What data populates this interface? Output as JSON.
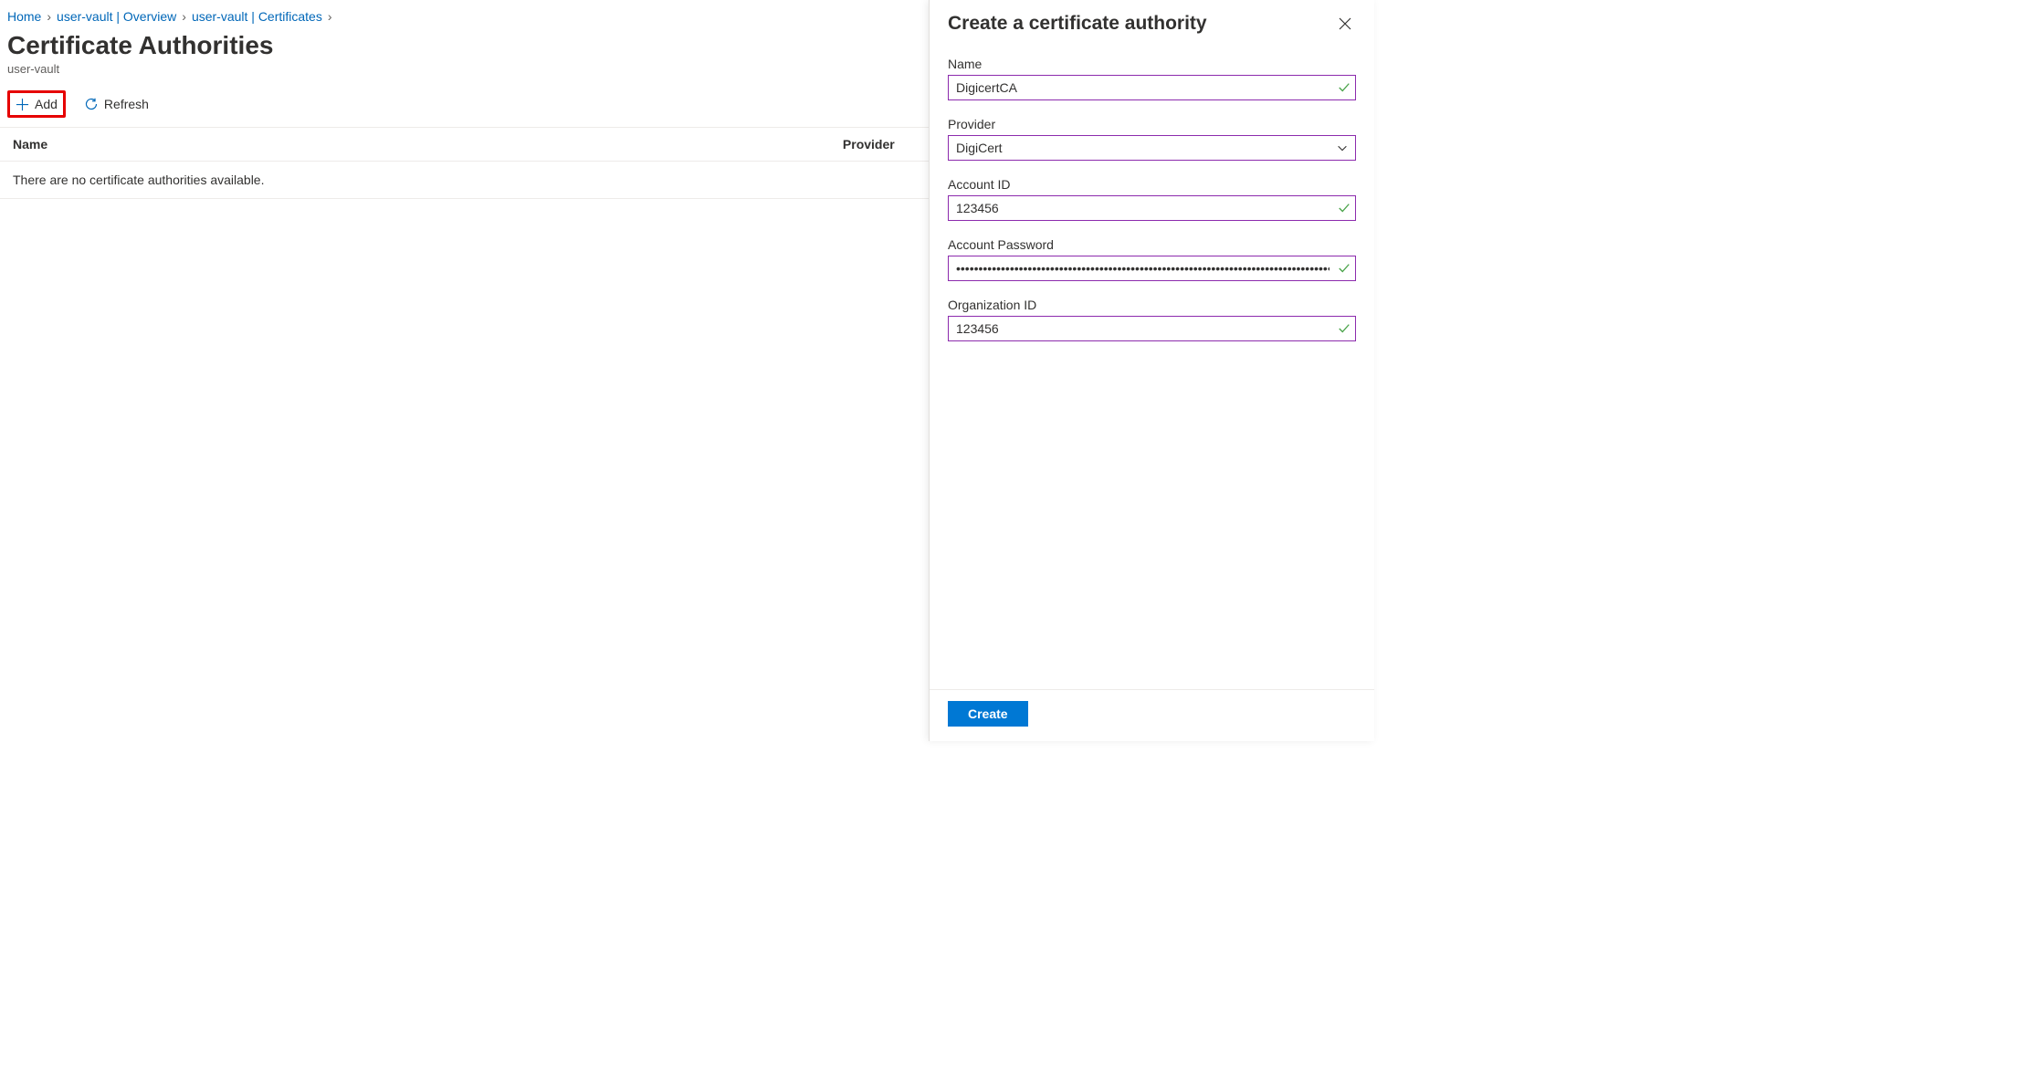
{
  "breadcrumb": {
    "items": [
      {
        "label": "Home"
      },
      {
        "label": "user-vault | Overview"
      },
      {
        "label": "user-vault | Certificates"
      }
    ]
  },
  "page": {
    "title": "Certificate Authorities",
    "subtitle": "user-vault"
  },
  "toolbar": {
    "add_label": "Add",
    "refresh_label": "Refresh"
  },
  "table": {
    "col_name": "Name",
    "col_provider": "Provider",
    "empty_message": "There are no certificate authorities available."
  },
  "panel": {
    "title": "Create a certificate authority",
    "fields": {
      "name": {
        "label": "Name",
        "value": "DigicertCA"
      },
      "provider": {
        "label": "Provider",
        "value": "DigiCert"
      },
      "account_id": {
        "label": "Account ID",
        "value": "123456"
      },
      "account_pwd": {
        "label": "Account Password",
        "value": "••••••••••••••••••••••••••••••••••••••••••••••••••••••••••••••••••••••••••••••••••••••••••••••••"
      },
      "org_id": {
        "label": "Organization ID",
        "value": "123456"
      }
    },
    "create_label": "Create"
  }
}
